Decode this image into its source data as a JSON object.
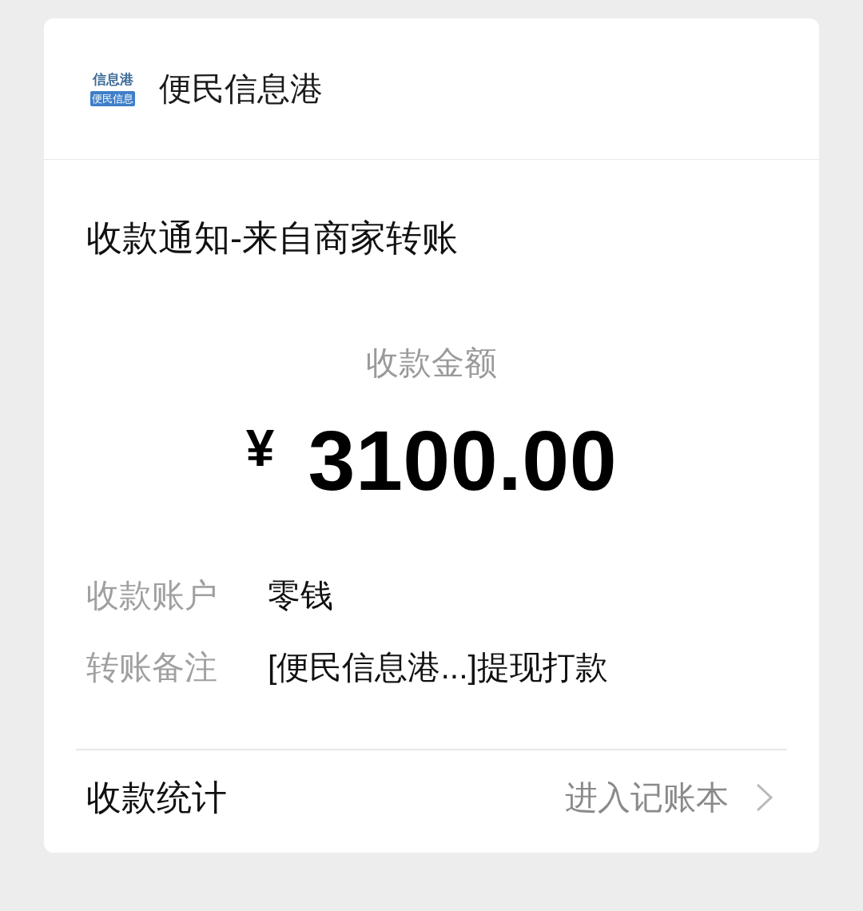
{
  "header": {
    "logo": {
      "top_text": "信息港",
      "tile_text": "便民信息"
    },
    "title": "便民信息港"
  },
  "notice": {
    "title": "收款通知-来自商家转账",
    "amount_label": "收款金额",
    "currency": "¥",
    "amount": "3100.00",
    "details": [
      {
        "label": "收款账户",
        "value": "零钱"
      },
      {
        "label": "转账备注",
        "value": "[便民信息港...]提现打款"
      }
    ]
  },
  "footer": {
    "label": "收款统计",
    "link": "进入记账本"
  }
}
